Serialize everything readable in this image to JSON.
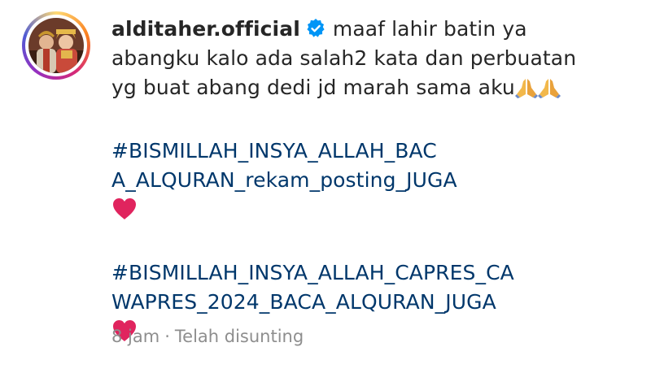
{
  "comment": {
    "username": "alditaher.official",
    "verified": true,
    "text_lines": [
      "maaf lahir batin ya",
      "abangku kalo ada salah2 kata dan perbuatan",
      "yg buat abang dedi jd marah sama aku"
    ],
    "hashtag_1_lines": [
      "#BISMILLAH_INSYA_ALLAH_BAC",
      "A_ALQURAN_rekam_posting_JUGA"
    ],
    "hashtag_2_lines": [
      "#BISMILLAH_INSYA_ALLAH_CAPRES_CA",
      "WAPRES_2024_BACA_ALQURAN_JUGA"
    ],
    "emojis": {
      "pray": "folded-hands-icon",
      "heart": "red-heart-icon"
    },
    "time": "8 jam",
    "separator": "·",
    "edited_label": "Telah disunting"
  },
  "colors": {
    "text": "#262626",
    "hashtag": "#00376b",
    "meta": "#8e8e8e",
    "verified": "#0095f6",
    "heart": "#e0245e"
  }
}
